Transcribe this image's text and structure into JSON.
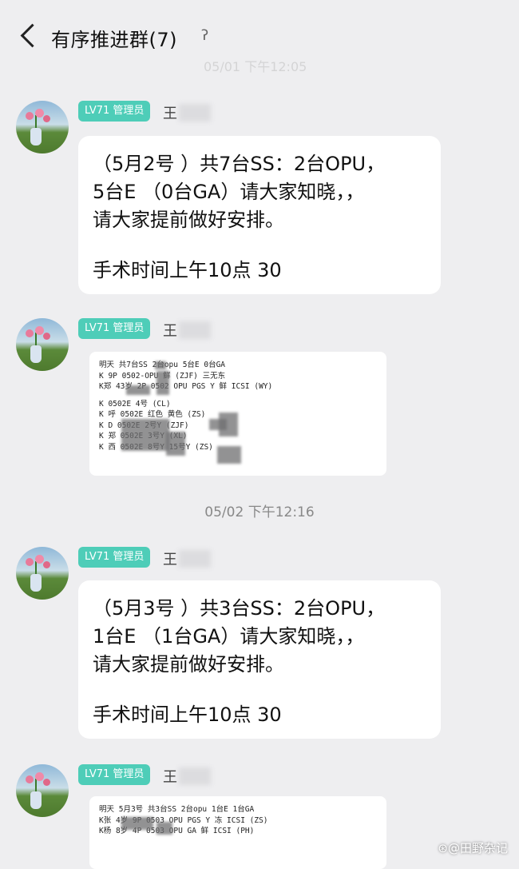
{
  "header": {
    "title": "有序推进群(7)",
    "ear_icon": "ear-icon",
    "faded_time": "05/01 下午12:05"
  },
  "timestamp": "05/02 下午12:16",
  "watermark": "⊛@田野杂记",
  "messages": [
    {
      "badge": "LV71 管理员",
      "sender": "王",
      "type": "text",
      "lines": [
        "（5月2号 ）共7台SS：2台OPU，",
        "5台E （0台GA）请大家知晓，，",
        "请大家提前做好安排。",
        "",
        "手术时间上午10点 30"
      ]
    },
    {
      "badge": "LV71 管理员",
      "sender": "王",
      "type": "image",
      "rows": [
        "明天       共7台SS  2台opu   5台E   0台GA",
        "K          9P 0502-OPU        鲜  (ZJF) 三无东",
        "K郑         43岁 2P 0502 OPU PGS Y 鲜 ICSI (WY)",
        "",
        "K                     0502E 4号        (CL)",
        "K                   呼 0502E 红色 黄色   (ZS)",
        "K             D       0502E 2号Y       (ZJF)",
        "K              郑      0502E 3号Y       (XL)",
        "K                   西 0502E 8号Y 15号Y (ZS)"
      ]
    },
    {
      "badge": "LV71 管理员",
      "sender": "王",
      "type": "text",
      "lines": [
        "（5月3号 ）共3台SS：2台OPU，",
        "1台E （1台GA）请大家知晓，，",
        "请大家提前做好安排。",
        "",
        "手术时间上午10点 30"
      ]
    },
    {
      "badge": "LV71 管理员",
      "sender": "王",
      "type": "image",
      "rows": [
        "明天 5月3号  共3台SS  2台opu   1台E   1台GA",
        "K张          4岁 9P 0503 OPU PGS Y 冻 ICSI (ZS)",
        "K杨          8岁 4P 0503 OPU      GA 鲜 ICSI (PH)"
      ]
    }
  ]
}
